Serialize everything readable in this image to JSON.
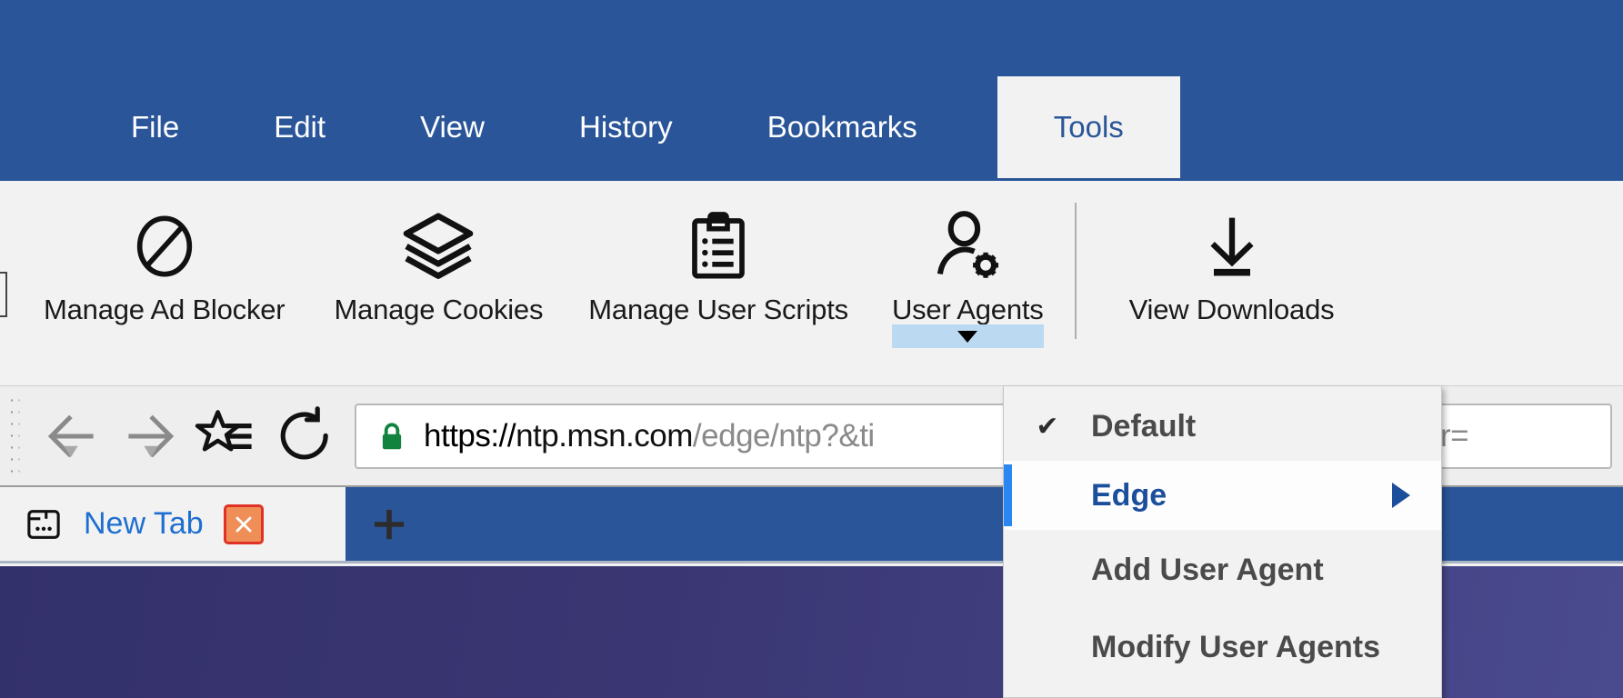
{
  "window": {
    "accent_blue": "#2a5699",
    "toolbar_bg": "#f2f2f2",
    "content_gradient_from": "#33316b",
    "content_gradient_to": "#4a4a8f"
  },
  "menubar": {
    "items": [
      {
        "label": "File",
        "active": false
      },
      {
        "label": "Edit",
        "active": false
      },
      {
        "label": "View",
        "active": false
      },
      {
        "label": "History",
        "active": false
      },
      {
        "label": "Bookmarks",
        "active": false
      },
      {
        "label": "Tools",
        "active": true
      }
    ]
  },
  "toolbar": {
    "buttons": [
      {
        "label": "Manage Ad Blocker",
        "icon": "no-entry-icon",
        "has_dropdown": false
      },
      {
        "label": "Manage Cookies",
        "icon": "layers-icon",
        "has_dropdown": false
      },
      {
        "label": "Manage User Scripts",
        "icon": "clipboard-list-icon",
        "has_dropdown": false
      },
      {
        "label": "User Agents",
        "icon": "user-gear-icon",
        "has_dropdown": true
      },
      {
        "label": "View Downloads",
        "icon": "download-arrow-icon",
        "has_dropdown": false
      }
    ]
  },
  "navbar": {
    "back_icon": "back-arrow-icon",
    "forward_icon": "forward-arrow-icon",
    "favorites_icon": "star-list-icon",
    "reload_icon": "reload-icon",
    "security_icon": "green-padlock-icon",
    "url": {
      "scheme": "https://",
      "host": "ntp.msn.com",
      "path": "/edge/ntp?&ti",
      "tail": ".prerender="
    }
  },
  "tabstrip": {
    "tabs": [
      {
        "title": "New Tab",
        "favicon": "window-dots-icon",
        "close_label": "✕"
      }
    ],
    "new_tab_label": "+"
  },
  "user_agents_menu": {
    "items": [
      {
        "label": "Default",
        "checked": true,
        "highlighted": false,
        "submenu": false
      },
      {
        "label": "Edge",
        "checked": false,
        "highlighted": true,
        "submenu": true
      },
      {
        "label": "Add User Agent",
        "checked": false,
        "highlighted": false,
        "submenu": false
      },
      {
        "label": "Modify User Agents",
        "checked": false,
        "highlighted": false,
        "submenu": false
      }
    ],
    "check_glyph": "✔"
  }
}
